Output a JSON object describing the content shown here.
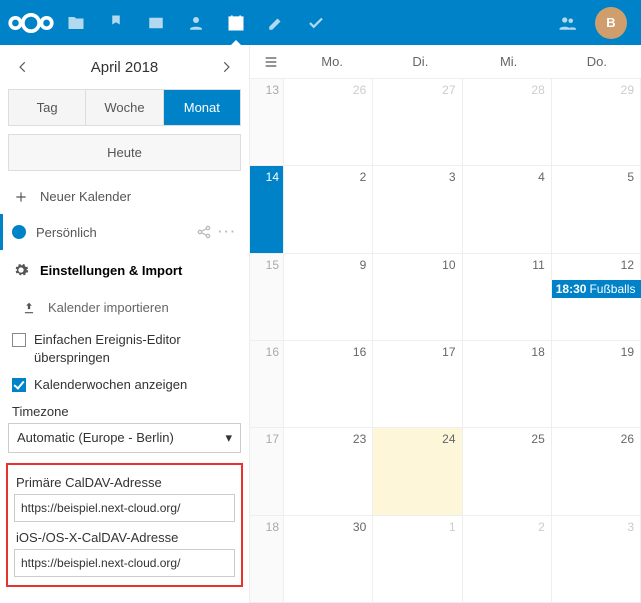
{
  "topbar": {
    "avatar_initial": "B"
  },
  "sidebar": {
    "month_title": "April 2018",
    "views": {
      "day": "Tag",
      "week": "Woche",
      "month": "Monat"
    },
    "today": "Heute",
    "new_calendar": "Neuer Kalender",
    "calendars": [
      {
        "name": "Persönlich",
        "color": "#0082c9"
      }
    ],
    "settings": "Einstellungen & Import",
    "import_cal": "Kalender importieren",
    "simple_editor": "Einfachen Ereignis-Editor überspringen",
    "show_weeks": "Kalenderwochen anzeigen",
    "timezone_label": "Timezone",
    "timezone_select": "Automatic (Europe - Berlin)",
    "caldav": {
      "primary_label": "Primäre CalDAV-Adresse",
      "primary_url": "https://beispiel.next-cloud.org/",
      "ios_label": "iOS-/OS-X-CalDAV-Adresse",
      "ios_url": "https://beispiel.next-cloud.org/"
    }
  },
  "calendar": {
    "weekdays": [
      "Mo.",
      "Di.",
      "Mi.",
      "Do."
    ],
    "weeks": [
      {
        "wk": "13",
        "days": [
          {
            "n": "26",
            "other": true
          },
          {
            "n": "27",
            "other": true
          },
          {
            "n": "28",
            "other": true
          },
          {
            "n": "29",
            "other": true
          }
        ]
      },
      {
        "wk": "14",
        "hl": true,
        "days": [
          {
            "n": "2"
          },
          {
            "n": "3"
          },
          {
            "n": "4"
          },
          {
            "n": "5"
          }
        ]
      },
      {
        "wk": "15",
        "days": [
          {
            "n": "9"
          },
          {
            "n": "10"
          },
          {
            "n": "11"
          },
          {
            "n": "12",
            "events": [
              {
                "time": "18:30",
                "title": "Fußballs",
                "cut": "15:0"
              }
            ]
          }
        ]
      },
      {
        "wk": "16",
        "days": [
          {
            "n": "16"
          },
          {
            "n": "17"
          },
          {
            "n": "18"
          },
          {
            "n": "19"
          }
        ]
      },
      {
        "wk": "17",
        "days": [
          {
            "n": "23"
          },
          {
            "n": "24",
            "today": true
          },
          {
            "n": "25"
          },
          {
            "n": "26"
          }
        ]
      },
      {
        "wk": "18",
        "days": [
          {
            "n": "30"
          },
          {
            "n": "1",
            "other": true
          },
          {
            "n": "2",
            "other": true
          },
          {
            "n": "3",
            "other": true
          }
        ]
      }
    ]
  }
}
